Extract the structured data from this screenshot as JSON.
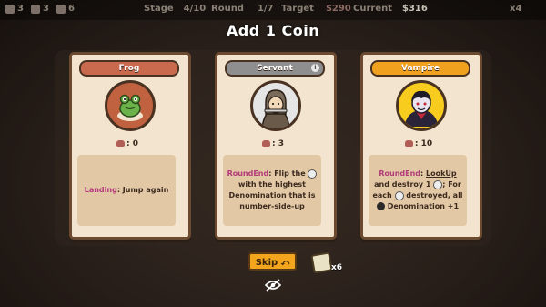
{
  "hud": {
    "stat1": "3",
    "stat2": "3",
    "stat3": "6",
    "stage_label": "Stage",
    "stage_value": "4/10",
    "round_label": "Round",
    "round_value": "1/7",
    "target_label": "Target",
    "target_value": "$290",
    "current_label": "Current",
    "current_value": "$316",
    "speed": "x4"
  },
  "title": "Add 1 Coin",
  "cards": [
    {
      "name": "Frog",
      "price": ": 0",
      "keyword": "Landing",
      "text": ": Jump again",
      "colors": {
        "header": "#c96a4f",
        "portrait": "#c0623f"
      }
    },
    {
      "name": "Servant",
      "price": ": 3",
      "keyword": "RoundEnd",
      "text_a": ": Flip the",
      "text_b": "with the highest Denomination that is number-side-up",
      "colors": {
        "header": "#8f8f8f",
        "portrait": "#e5e5e5"
      }
    },
    {
      "name": "Vampire",
      "price": ": 10",
      "keyword": "RoundEnd",
      "colon": ": ",
      "link": "LookUp",
      "text_a": "and destroy 1",
      "text_b": "; For each",
      "text_c": "destroyed, all",
      "text_d": "Denomination +1",
      "colors": {
        "header": "#f0a21f",
        "portrait": "#f7cc1f"
      }
    }
  ],
  "controls": {
    "skip_label": "Skip",
    "reroll_count": "x6",
    "hide_icon": "eye-slash-icon"
  },
  "palette": {
    "keyword": "#b33a78",
    "card_bg": "#f2e4cf",
    "skip_bg": "#f2a51d"
  }
}
